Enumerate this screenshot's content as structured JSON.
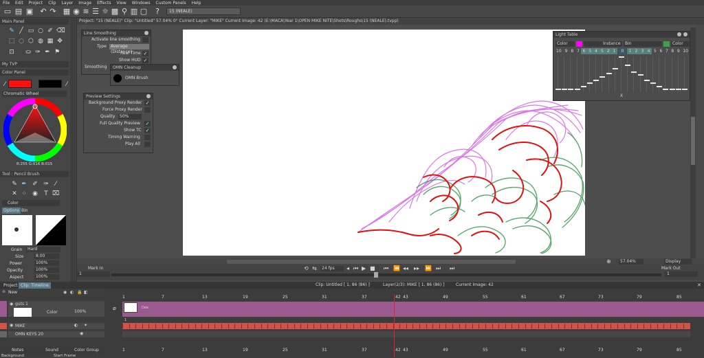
{
  "menu": [
    "File",
    "Edit",
    "Project",
    "Clip",
    "Layer",
    "Image",
    "Effects",
    "View",
    "Windows",
    "Custom Panels",
    "Help"
  ],
  "toolbar": {
    "project_name": "15 (NEALE)"
  },
  "infobar": {
    "text": "Project: \"15 (NEALE)\"   Clip: \"Untitled\"   57.04%   0°   Current Layer: \"MIKE\"   Current Image: 42 (E:\\MACA\\Year 1\\OPEN MIKE NITE\\Shots\\Roughs\\15 (NEALE).tvpp)"
  },
  "left_panels": {
    "main_panel": "Main Panel",
    "my_tvp": "My TVP",
    "color_panel": "Color Panel",
    "chromatic_wheel": "Chromatic Wheel",
    "rgb_readout": "R:255 G:016 B:015",
    "tool_title": "Tool : Pencil Brush",
    "color_label": "Color",
    "options_tab": "Options",
    "bin_tab": "Bin",
    "grain_label": "Grain",
    "grain_value": "Hard",
    "size_label": "Size",
    "size_value": "8.00",
    "power_label": "Power",
    "power_value": "100%",
    "opacity_label": "Opacity",
    "opacity_value": "100%",
    "aspect_label": "Aspect",
    "aspect_value": "100%"
  },
  "colors": {
    "primary": "#ff100f",
    "secondary": "#000000",
    "pink_track": "#9a5a8f",
    "red_track": "#d0544a"
  },
  "line_smoothing": {
    "title": "Line Smoothing",
    "activate": "Activate line smoothing",
    "type_label": "Type",
    "type_value": "Average (Distance)",
    "real_time": "Real Time",
    "show_hud": "Show HUD",
    "smoothing": "Smoothing"
  },
  "omn_cleanup": {
    "title": "OMN Cleanup",
    "brush": "OMN Brush"
  },
  "preview_settings": {
    "title": "Preview Settings",
    "bg_proxy": "Background Proxy Render",
    "force_proxy": "Force Proxy Render",
    "quality_label": "Quality",
    "quality_value": "50%",
    "full_quality": "Full Quality Preview",
    "show_tc": "Show TC",
    "timing_warning": "Timing Warning",
    "play_all": "Play All"
  },
  "light_table": {
    "title": "Light Table",
    "color_btn": "Color",
    "instance_btn": "Instance",
    "bin_btn": "Bin",
    "color_btn2": "Color",
    "left_nums": [
      "10",
      "9",
      "8",
      "7"
    ],
    "mid_nums": [
      "6",
      "5",
      "4",
      "5",
      "2",
      "1"
    ],
    "zero": "0",
    "right_nums": [
      "1",
      "2",
      "3",
      "4",
      "5",
      "6",
      "7",
      "8",
      "9",
      "10"
    ],
    "x_label": "X",
    "opacities": [
      0.02,
      0.02,
      0.02,
      0.02,
      0.1,
      0.2,
      0.3,
      0.4,
      0.5,
      0.65,
      1,
      0.75,
      0.55,
      0.45,
      0.3,
      0.2,
      0.1,
      0.02,
      0.02,
      0.02,
      0.02
    ]
  },
  "nav": {
    "zoom": "57.04%",
    "display": "Display"
  },
  "playback": {
    "mark_in": "Mark In",
    "fps": "24 fps",
    "mark_out": "Mark Out",
    "in_value": "1",
    "out_value": "1"
  },
  "timeline": {
    "project_tab": "Project",
    "clip_tab": "Clip: Timeline",
    "clip_info": "Clip: Untitled [ 1, 86 (86) ]",
    "layer_info": "Layer(2/3): MIKE [ 1, 86 (86) ]",
    "current_image": "Current Image: 42",
    "new_label": "New",
    "layer1": "guts 1",
    "layer1_color": "Color",
    "layer1_opacity": "100%",
    "layer2": "MIKE",
    "layer3": "OMN KEYS 20",
    "frame1_label": "1",
    "frame1_text": "Dee",
    "frames": [
      "1",
      "7",
      "13",
      "19",
      "25",
      "31",
      "37",
      "42",
      "43",
      "49",
      "55",
      "61",
      "67",
      "73",
      "79",
      "85"
    ],
    "notes": "Notes",
    "sound": "Sound",
    "color_group": "Color Group",
    "background": "Background",
    "start_frame": "Start Frame"
  }
}
